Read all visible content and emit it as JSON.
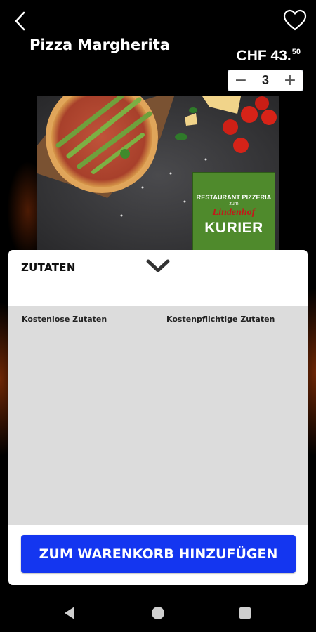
{
  "header": {
    "title": "Pizza Margherita",
    "price_main": "CHF 43.",
    "price_cents": "50",
    "quantity": "3",
    "back_icon": "chevron-left-icon",
    "favorite_icon": "heart-outline-icon",
    "minus_symbol": "−",
    "plus_symbol": "+"
  },
  "product_image": {
    "badge_line1": "RESTAURANT PIZZERIA",
    "badge_line2": "zum",
    "badge_line3": "Lindenhof",
    "badge_line4": "KURIER"
  },
  "ingredients_panel": {
    "title": "ZUTATEN",
    "collapse_icon": "chevron-down-icon",
    "free_label": "Kostenlose Zutaten",
    "paid_label": "Kostenpflichtige Zutaten"
  },
  "cta": {
    "label": "ZUM WARENKORB HINZUFÜGEN",
    "color": "#1436f0"
  },
  "system_nav": {
    "back_icon": "triangle-back-icon",
    "home_icon": "circle-home-icon",
    "recents_icon": "square-recents-icon"
  }
}
